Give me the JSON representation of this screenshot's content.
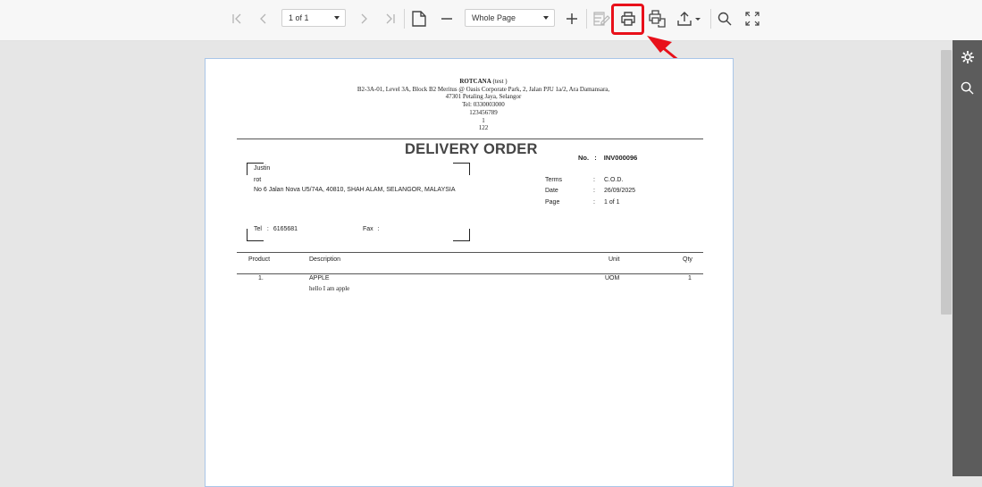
{
  "toolbar": {
    "page_select": "1 of 1",
    "zoom_select": "Whole Page"
  },
  "icons": {
    "first": "first-page-icon",
    "prev": "previous-page-icon",
    "next": "next-page-icon",
    "last": "last-page-icon",
    "single_page": "single-page-icon",
    "zoom_out": "zoom-out-icon",
    "zoom_in": "zoom-in-icon",
    "edit": "edit-icon",
    "print": "print-icon",
    "print_page": "print-page-icon",
    "export": "export-icon",
    "search": "search-icon",
    "fullscreen": "fullscreen-icon",
    "settings": "gear-icon",
    "side_search": "search-icon"
  },
  "colors": {
    "highlight": "#e8101a",
    "arrow": "#e8101a",
    "sidebar": "#5c5c5c"
  },
  "document": {
    "company_name": "ROTCANA",
    "company_suffix": " (test )",
    "address1": "B2-3A-01, Level 3A, Block B2 Meritus @ Oasis Corporate Park, 2, Jalan PJU 1a/2, Ara Damansara,",
    "address2": "47301 Petaling Jaya, Selangor",
    "tel": "Tel: 0330003000",
    "line4": "123456789",
    "line5": "1",
    "line6": "122",
    "title": "DELIVERY ORDER",
    "no_label": "No.",
    "no_colon": ":",
    "no_value": "INV000096",
    "customer": {
      "name": "Justin",
      "company": "rot",
      "address": "No 6 Jalan Nova U5/74A, 40810, SHAH ALAM, SELANGOR, MALAYSIA",
      "tel_label": "Tel",
      "tel_colon": ":",
      "tel_value": "6165681",
      "fax_label": "Fax",
      "fax_colon": ":"
    },
    "terms": [
      {
        "label": "Terms",
        "colon": ":",
        "value": "C.O.D."
      },
      {
        "label": "Date",
        "colon": ":",
        "value": "26/09/2025"
      },
      {
        "label": "Page",
        "colon": ":",
        "value": "1 of 1"
      }
    ],
    "table": {
      "headers": {
        "product": "Product",
        "description": "Description",
        "unit": "Unit",
        "qty": "Qty"
      },
      "rows": [
        {
          "no": "1.",
          "description": "APPLE",
          "note": "hello I am apple",
          "unit": "UOM",
          "qty": "1"
        }
      ]
    }
  }
}
